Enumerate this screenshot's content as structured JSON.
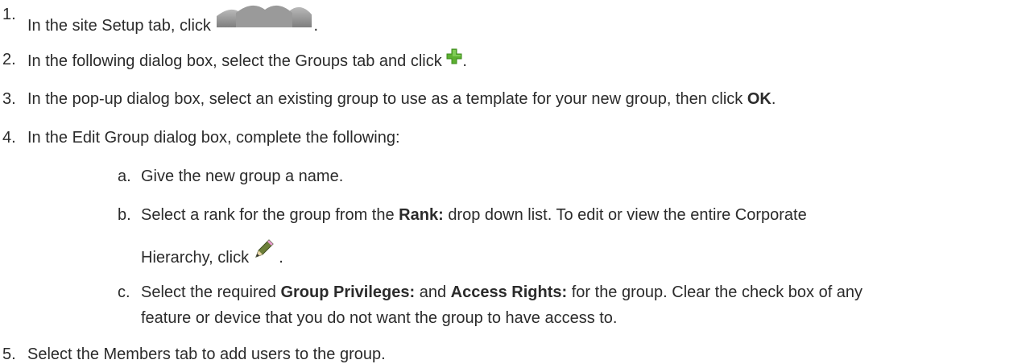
{
  "steps": [
    {
      "num": "1.",
      "before": "In the site Setup tab, click",
      "after": "."
    },
    {
      "num": "2.",
      "before": "In the following dialog box, select the Groups tab and click",
      "after": "."
    },
    {
      "num": "3.",
      "before": "In the pop-up dialog box, select an existing group to use as a template for your new group, then click",
      "bold": "OK",
      "after": "."
    },
    {
      "num": "4.",
      "text": "In the Edit Group dialog box, complete the following:"
    },
    {
      "num": "5.",
      "text": "Select the Members tab to add users to the group."
    }
  ],
  "substeps": [
    {
      "num": "a.",
      "text": "Give the new group a name."
    },
    {
      "num": "b.",
      "before": "Select a rank for the group from the",
      "bold": "Rank:",
      "after": "drop down list. To edit or view the entire Corporate",
      "cont": "Hierarchy, click",
      "cont_after": "."
    },
    {
      "num": "c.",
      "before": "Select the required",
      "bold1": "Group Privileges:",
      "mid": "and",
      "bold2": "Access Rights:",
      "after": "for the group. Clear the check box of any",
      "cont": "feature or device that you do not want the group to have access to."
    }
  ],
  "icons": {
    "step1": "users-group-icon",
    "step2": "add-plus-icon",
    "stepb": "edit-pencil-icon"
  },
  "colors": {
    "text": "#2b2b2b",
    "plus_green": "#5cb030",
    "group_gray": "#8c8c8c"
  }
}
